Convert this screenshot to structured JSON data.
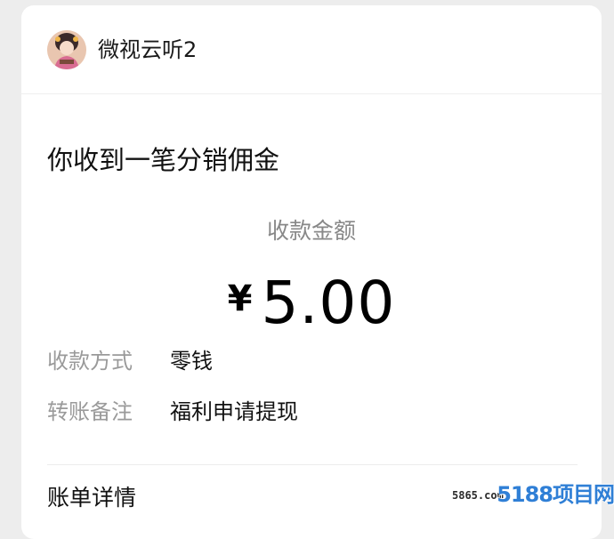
{
  "header": {
    "app_name": "微视云听2",
    "avatar_icon": "profile-avatar"
  },
  "message": {
    "title": "你收到一笔分销佣金",
    "amount_label": "收款金额",
    "currency_symbol": "¥",
    "amount": "5.00"
  },
  "rows": [
    {
      "label": "收款方式",
      "value": "零钱"
    },
    {
      "label": "转账备注",
      "value": "福利申请提现"
    }
  ],
  "footer": {
    "detail_link": "账单详情"
  },
  "watermark": {
    "small_text": "5865.com",
    "logo_text": "5188项目网"
  }
}
